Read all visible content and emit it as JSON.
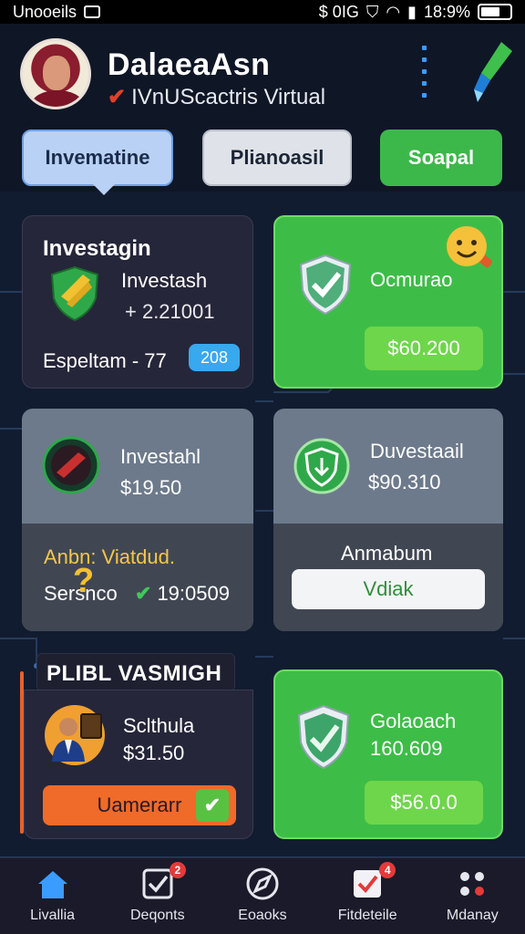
{
  "status_bar": {
    "carrier": "Unooeils",
    "center": "$ 0IG",
    "time": "18:9%"
  },
  "header": {
    "title": "DalaeaAsn",
    "subtitle": "IVnUScactris Virtual"
  },
  "tabs": [
    {
      "label": "Invematine"
    },
    {
      "label": "Plianoasil"
    },
    {
      "label": "Soapal"
    }
  ],
  "cards": {
    "c1": {
      "title": "Investagin",
      "line1": "Investash",
      "line2": "+ 2.21001",
      "footer": "Espeltam - 77",
      "badge": "208"
    },
    "c2": {
      "title": "Ocmurao",
      "amount": "$60.200"
    },
    "c3": {
      "line1": "Investahl",
      "line2": "$19.50",
      "lower1": "Anbn: Viatdud.",
      "lower2": "Sersnco",
      "lower_value": "19:0509"
    },
    "c4": {
      "line1": "Duvestaail",
      "line2": "$90.310",
      "lower_title": "Anmabum",
      "button": "Vdiak"
    },
    "section_label": "PLIBL VASMIGH",
    "c5": {
      "line1": "Sclthula",
      "line2": "$31.50",
      "button": "Uamerarr"
    },
    "c6": {
      "line1": "Golaoach",
      "line2": "160.609",
      "amount": "$56.0.0"
    }
  },
  "bottom_nav": [
    {
      "label": "Livallia",
      "icon": "home-icon"
    },
    {
      "label": "Deqonts",
      "icon": "checkbox-icon",
      "badge": "2"
    },
    {
      "label": "Eoaoks",
      "icon": "compass-icon"
    },
    {
      "label": "Fitdeteile",
      "icon": "heart-check-icon",
      "badge": "4"
    },
    {
      "label": "Mdanay",
      "icon": "dots-grid-icon"
    }
  ],
  "colors": {
    "background": "#0f1626",
    "green": "#3dbd47",
    "accent_blue": "#3b9cff",
    "orange": "#f06a2a"
  }
}
